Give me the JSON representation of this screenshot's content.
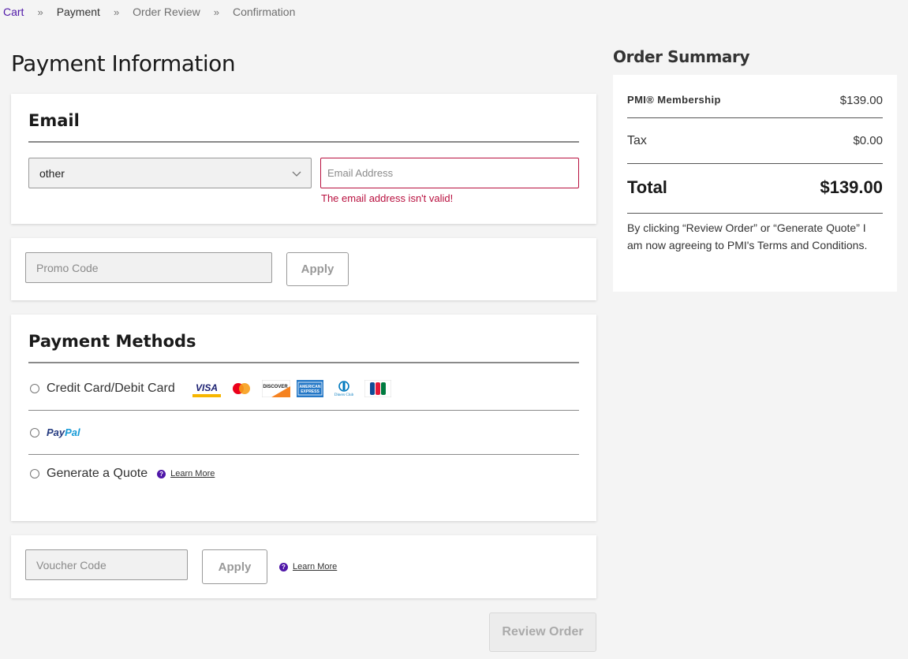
{
  "breadcrumb": {
    "items": [
      "Cart",
      "Payment",
      "Order Review",
      "Confirmation"
    ],
    "separator": "»"
  },
  "page_title": "Payment Information",
  "email_section": {
    "title": "Email",
    "type_select_value": "other",
    "email_placeholder": "Email Address",
    "email_value": "",
    "error_text": "The email address isn't valid!"
  },
  "promo": {
    "placeholder": "Promo Code",
    "apply_label": "Apply"
  },
  "payment_methods": {
    "title": "Payment Methods",
    "credit_card_label": "Credit Card/Debit Card",
    "card_brands": [
      "visa-icon",
      "mastercard-icon",
      "discover-icon",
      "amex-icon",
      "diners-club-icon",
      "jcb-icon"
    ],
    "paypal_pay": "Pay",
    "paypal_pal": "Pal",
    "quote_label": "Generate a Quote",
    "learn_more": "Learn More"
  },
  "voucher": {
    "placeholder": "Voucher Code",
    "apply_label": "Apply",
    "learn_more": "Learn More"
  },
  "review_order_label": "Review Order",
  "summary": {
    "title": "Order Summary",
    "membership_label": "PMI® Membership",
    "membership_value": "$139.00",
    "tax_label": "Tax",
    "tax_value": "$0.00",
    "total_label": "Total",
    "total_value": "$139.00",
    "note": "By clicking “Review Order” or “Generate Quote” I am now agreeing to PMI's Terms and Conditions."
  },
  "colors": {
    "accent": "#4f17a8",
    "error": "#b8103f",
    "background": "#f4f4f4"
  }
}
